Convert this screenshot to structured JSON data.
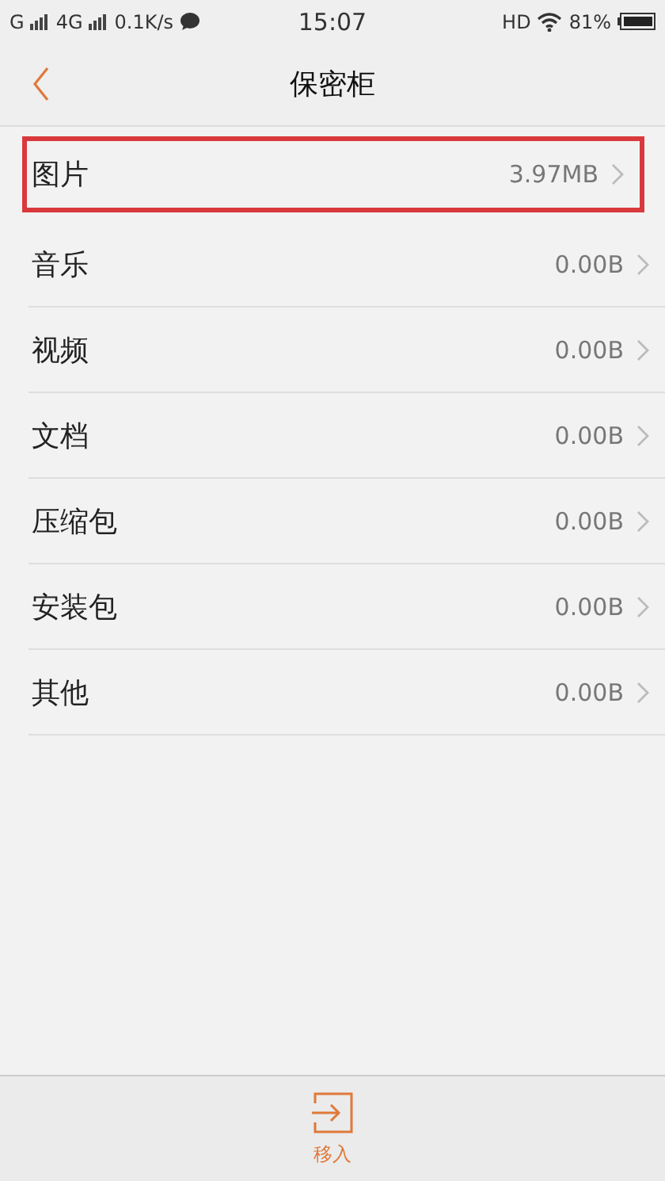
{
  "status_bar": {
    "carrier_1": "G",
    "carrier_2": "4G",
    "speed": "0.1K/s",
    "time": "15:07",
    "hd": "HD",
    "battery": "81%"
  },
  "nav": {
    "title": "保密柜"
  },
  "items": [
    {
      "label": "图片",
      "size": "3.97MB",
      "selected": true
    },
    {
      "label": "音乐",
      "size": "0.00B",
      "selected": false
    },
    {
      "label": "视频",
      "size": "0.00B",
      "selected": false
    },
    {
      "label": "文档",
      "size": "0.00B",
      "selected": false
    },
    {
      "label": "压缩包",
      "size": "0.00B",
      "selected": false
    },
    {
      "label": "安装包",
      "size": "0.00B",
      "selected": false
    },
    {
      "label": "其他",
      "size": "0.00B",
      "selected": false
    }
  ],
  "bottom": {
    "label": "移入"
  }
}
